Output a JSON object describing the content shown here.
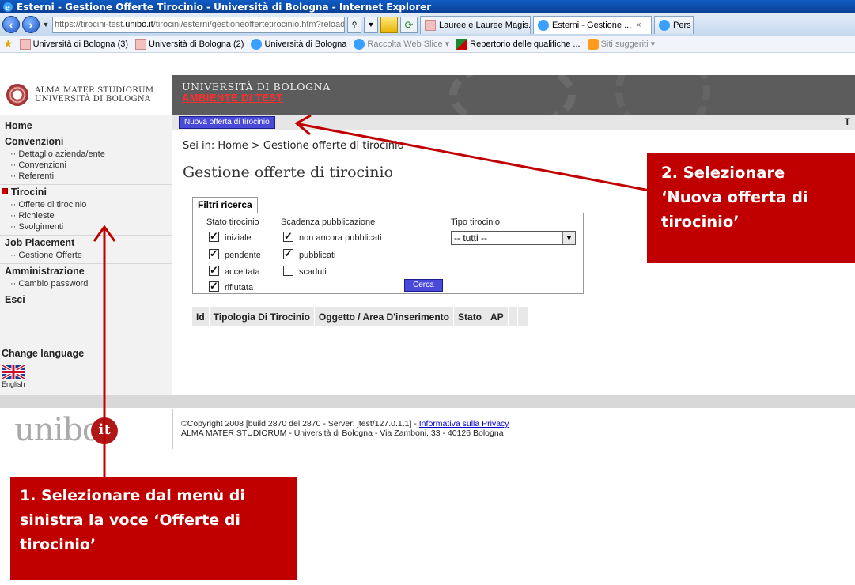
{
  "window": {
    "title": "Esterni - Gestione Offerte Tirocinio - Università di Bologna - Internet Explorer"
  },
  "browser": {
    "url_prefix": "https://tirocini-test.",
    "url_host": "unibo.it",
    "url_path": "/tirocini/esterni/gestioneoffertetirocinio.htm?reload=",
    "tabs": [
      {
        "label": "Lauree e Lauree Magis...",
        "active": false
      },
      {
        "label": "Esterni - Gestione ...",
        "active": true
      },
      {
        "label": "Pers",
        "active": false
      }
    ],
    "tab_close_glyph": "×"
  },
  "favorites": [
    {
      "label": "Università di Bologna (3)",
      "icon": "unibo-favicon",
      "dim": false
    },
    {
      "label": "Università di Bologna (2)",
      "icon": "unibo-favicon",
      "dim": false
    },
    {
      "label": "Università di Bologna",
      "icon": "ie-favicon",
      "dim": false
    },
    {
      "label": "Raccolta Web Slice ▾",
      "icon": "ie-favicon",
      "dim": true
    },
    {
      "label": "Repertorio delle qualifiche ...",
      "icon": "green-flag-favicon",
      "dim": false
    },
    {
      "label": "Siti suggeriti ▾",
      "icon": "suggested-sites-icon",
      "dim": true
    }
  ],
  "logo": {
    "line1": "ALMA MATER STUDIORUM",
    "line2": "UNIVERSITÀ DI BOLOGNA"
  },
  "header": {
    "university": "UNIVERSITÀ DI BOLOGNA",
    "environment": "AMBIENTE DI TEST"
  },
  "toolbar": {
    "new_offer": "Nuova offerta di tirocinio",
    "right_text": "T"
  },
  "sidebar": {
    "home": "Home",
    "convenzioni": {
      "title": "Convenzioni",
      "items": [
        "Dettaglio azienda/ente",
        "Convenzioni",
        "Referenti"
      ]
    },
    "tirocini": {
      "title": "Tirocini",
      "items": [
        "Offerte di tirocinio",
        "Richieste",
        "Svolgimenti"
      ]
    },
    "job_placement": {
      "title": "Job Placement",
      "items": [
        "Gestione Offerte"
      ]
    },
    "amministrazione": {
      "title": "Amministrazione",
      "items": [
        "Cambio password"
      ]
    },
    "esci": "Esci",
    "change_language": "Change language",
    "language_label": "English"
  },
  "main": {
    "breadcrumb": "Sei in: Home > Gestione offerte di tirocinio",
    "title": "Gestione offerte di tirocinio",
    "filters": {
      "tab": "Filtri ricerca",
      "stato_label": "Stato tirocinio",
      "stato": [
        {
          "label": "iniziale",
          "checked": true
        },
        {
          "label": "pendente",
          "checked": true
        },
        {
          "label": "accettata",
          "checked": true
        },
        {
          "label": "rifiutata",
          "checked": true
        }
      ],
      "scadenza_label": "Scadenza pubblicazione",
      "scadenza": [
        {
          "label": "non ancora pubblicati",
          "checked": true
        },
        {
          "label": "pubblicati",
          "checked": true
        },
        {
          "label": "scaduti",
          "checked": false
        }
      ],
      "tipo_label": "Tipo tirocinio",
      "tipo_value": "-- tutti --",
      "search_button": "Cerca"
    },
    "results_columns": [
      "Id",
      "Tipologia Di Tirocinio",
      "Oggetto / Area D'inserimento",
      "Stato",
      "AP",
      "",
      ""
    ]
  },
  "footer": {
    "logo_text": "unibo",
    "logo_dot": "it",
    "copyright": "©Copyright 2008 [build.2870 del 2870 - Server: jtest/127.0.1.1] - ",
    "privacy_link": "Informativa sulla Privacy",
    "address": "ALMA MATER STUDIORUM - Università di Bologna - Via Zamboni, 33 - 40126 Bologna"
  },
  "annotations": {
    "step1": "1. Selezionare dal menù di sinistra la voce ‘Offerte di tirocinio’",
    "step2": "2. Selezionare ‘Nuova offerta di tirocinio’"
  },
  "colors": {
    "annotation_red": "#c00000",
    "button_blue": "#4a4ad8",
    "header_gray": "#5c5c5c",
    "test_red": "#ff2d2d"
  }
}
